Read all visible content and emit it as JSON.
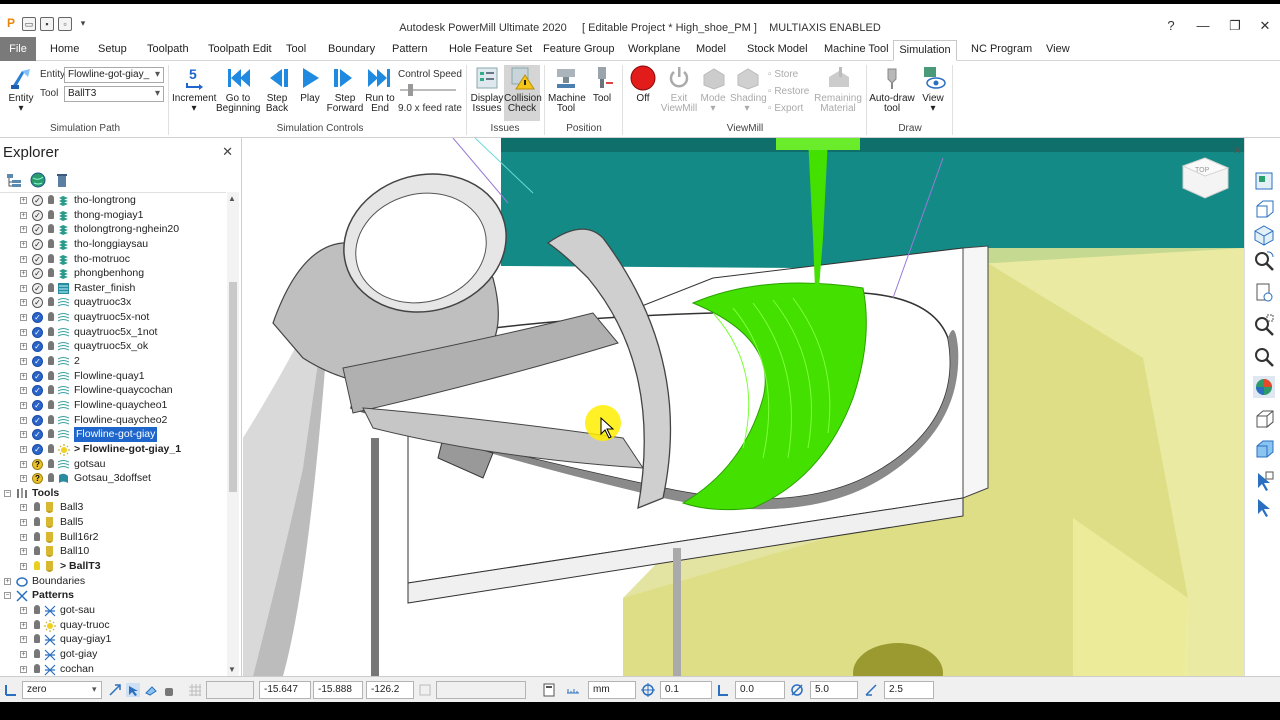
{
  "window": {
    "title": "Autodesk PowerMill Ultimate 2020",
    "project": "[ Editable Project * High_shoe_PM ]",
    "mode": "MULTIAXIS ENABLED",
    "help": "?",
    "minimize": "—",
    "restore": "❐",
    "close": "✕"
  },
  "tabs": [
    "File",
    "Home",
    "Setup",
    "Toolpath",
    "Toolpath Edit",
    "Tool",
    "Boundary",
    "Pattern",
    "Hole Feature Set",
    "Feature Group",
    "Workplane",
    "Model",
    "Stock Model",
    "Machine Tool",
    "Simulation",
    "NC Program",
    "View"
  ],
  "active_tab": "Simulation",
  "ribbon": {
    "simulation_path": {
      "entity_btn": "Entity",
      "entity_label": "Entity",
      "entity_value": "Flowline-got-giay_",
      "tool_label": "Tool",
      "tool_value": "BallT3",
      "group": "Simulation Path"
    },
    "controls": {
      "increment": "Increment",
      "increment_value": "5",
      "go_begin": "Go to Beginning",
      "step_back": "Step Back",
      "play": "Play",
      "step_forward": "Step Forward",
      "run_end": "Run to End",
      "speed_label": "Control Speed",
      "speed_value": "9.0 x feed rate",
      "group": "Simulation Controls"
    },
    "issues": {
      "display": "Display Issues",
      "collision": "Collision Check",
      "group": "Issues"
    },
    "position": {
      "machine": "Machine Tool",
      "tool": "Tool",
      "group": "Position"
    },
    "viewmill": {
      "off": "Off",
      "exit": "Exit ViewMill",
      "mode": "Mode",
      "shading": "Shading",
      "store": "Store",
      "restore": "Restore",
      "export": "Export",
      "remaining": "Remaining Material",
      "group": "ViewMill"
    },
    "draw": {
      "auto": "Auto-draw tool",
      "view": "View",
      "group": "Draw"
    }
  },
  "explorer": {
    "title": "Explorer",
    "rows": [
      {
        "label": "tho-longtrong",
        "indent": 3,
        "chk": "tick",
        "icon": "toolpath-icon"
      },
      {
        "label": "thong-mogiay1",
        "indent": 3,
        "chk": "tick",
        "icon": "toolpath-icon"
      },
      {
        "label": "tholongtrong-nghein20",
        "indent": 3,
        "chk": "tick",
        "icon": "toolpath-icon"
      },
      {
        "label": "tho-longgiaysau",
        "indent": 3,
        "chk": "tick",
        "icon": "toolpath-icon"
      },
      {
        "label": "tho-motruoc",
        "indent": 3,
        "chk": "tick",
        "icon": "toolpath-icon"
      },
      {
        "label": "phongbenhong",
        "indent": 3,
        "chk": "tick",
        "icon": "toolpath-icon"
      },
      {
        "label": "Raster_finish",
        "indent": 3,
        "chk": "tick",
        "icon": "raster-icon"
      },
      {
        "label": "quaytruoc3x",
        "indent": 3,
        "chk": "tick",
        "icon": "flowline-icon"
      },
      {
        "label": "quaytruoc5x-not",
        "indent": 3,
        "chk": "blue",
        "icon": "flowline-icon"
      },
      {
        "label": "quaytruoc5x_1not",
        "indent": 3,
        "chk": "blue",
        "icon": "flowline-icon"
      },
      {
        "label": "quaytruoc5x_ok",
        "indent": 3,
        "chk": "blue",
        "icon": "flowline-icon"
      },
      {
        "label": "2",
        "indent": 3,
        "chk": "blue",
        "icon": "flowline-icon"
      },
      {
        "label": "Flowline-quay1",
        "indent": 3,
        "chk": "blue",
        "icon": "flowline-icon"
      },
      {
        "label": "Flowline-quaycochan",
        "indent": 3,
        "chk": "blue",
        "icon": "flowline-icon"
      },
      {
        "label": "Flowline-quaycheo1",
        "indent": 3,
        "chk": "blue",
        "icon": "flowline-icon"
      },
      {
        "label": "Flowline-quaycheo2",
        "indent": 3,
        "chk": "blue",
        "icon": "flowline-icon"
      },
      {
        "label": "Flowline-got-giay",
        "indent": 3,
        "chk": "blue",
        "icon": "flowline-icon",
        "selected": true
      },
      {
        "label": "> Flowline-got-giay_1",
        "indent": 3,
        "chk": "blue",
        "icon": "sun-icon",
        "bold": true
      },
      {
        "label": "gotsau",
        "indent": 3,
        "chk": "q",
        "icon": "flowline-icon"
      },
      {
        "label": "Gotsau_3doffset",
        "indent": 3,
        "chk": "q",
        "icon": "offset-icon"
      },
      {
        "label": "Tools",
        "indent": 0,
        "chk": "none",
        "icon": "tools-folder-icon",
        "bold": true,
        "expanded": true
      },
      {
        "label": "Ball3",
        "indent": 3,
        "chk": "none",
        "icon": "ball-tool-icon"
      },
      {
        "label": "Ball5",
        "indent": 3,
        "chk": "none",
        "icon": "ball-tool-icon"
      },
      {
        "label": "Bull16r2",
        "indent": 3,
        "chk": "none",
        "icon": "ball-tool-icon"
      },
      {
        "label": "Ball10",
        "indent": 3,
        "chk": "none",
        "icon": "ball-tool-icon"
      },
      {
        "label": "> BallT3",
        "indent": 3,
        "chk": "none",
        "icon": "ball-tool-icon",
        "bold": true
      },
      {
        "label": "Boundaries",
        "indent": 0,
        "chk": "none",
        "icon": "boundary-folder-icon"
      },
      {
        "label": "Patterns",
        "indent": 0,
        "chk": "none",
        "icon": "pattern-folder-icon",
        "bold": true,
        "expanded": true
      },
      {
        "label": "got-sau",
        "indent": 3,
        "chk": "none",
        "icon": "pattern-icon"
      },
      {
        "label": "quay-truoc",
        "indent": 3,
        "chk": "none",
        "icon": "sun-icon"
      },
      {
        "label": "quay-giay1",
        "indent": 3,
        "chk": "none",
        "icon": "pattern-icon"
      },
      {
        "label": "got-giay",
        "indent": 3,
        "chk": "none",
        "icon": "pattern-icon"
      },
      {
        "label": "cochan",
        "indent": 3,
        "chk": "none",
        "icon": "pattern-icon"
      }
    ]
  },
  "status": {
    "workplane": "zero",
    "x": "-15.647",
    "y": "-15.888",
    "z": "-126.2",
    "units": "mm",
    "tolerance": "0.1",
    "offset": "0.0",
    "diameter": "5.0",
    "stepover": "2.5"
  },
  "viewcube": "TOP",
  "colors": {
    "accent_blue": "#1f66cc",
    "toolpath_green": "#44e000",
    "machine_teal": "#138a85",
    "stock_yellow": "#e2e28a"
  }
}
